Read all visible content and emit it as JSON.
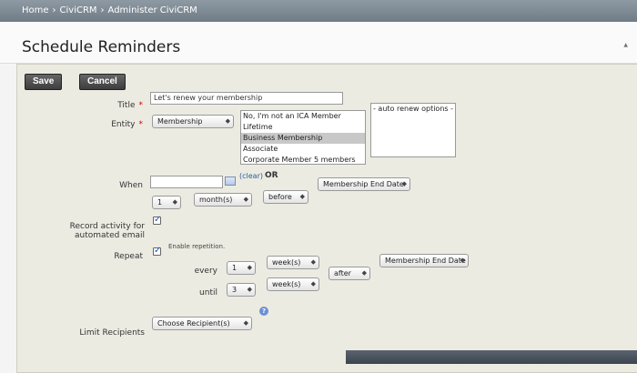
{
  "breadcrumb": {
    "items": [
      "Home",
      "CiviCRM",
      "Administer CiviCRM"
    ],
    "separator": "›"
  },
  "page": {
    "title": "Schedule Reminders"
  },
  "buttons": {
    "save": "Save",
    "cancel": "Cancel"
  },
  "fields": {
    "title": {
      "label": "Title",
      "value": "Let's renew your membership"
    },
    "entity": {
      "label": "Entity",
      "selected": "Membership",
      "options": [
        "No, I'm not an ICA Member",
        "Lifetime",
        "Business Membership",
        "Associate",
        "Corporate Member 5 members"
      ],
      "selected_option": "Business Membership",
      "auto_renew": "- auto renew options -"
    },
    "when": {
      "label": "When",
      "clear_link": "(clear)",
      "or": "OR",
      "number": "1",
      "unit": "month(s)",
      "relation": "before",
      "date_field": "Membership End Date"
    },
    "record_activity": {
      "label_line1": "Record activity for",
      "label_line2": "automated email"
    },
    "repeat": {
      "label": "Repeat",
      "enable_text": "Enable repetition.",
      "every_label": "every",
      "every_number": "1",
      "every_unit": "week(s)",
      "until_label": "until",
      "until_number": "3",
      "until_unit": "week(s)",
      "until_relation": "after",
      "until_date_field": "Membership End Date"
    },
    "limit_recipients": {
      "label": "Limit Recipients",
      "selected": "Choose Recipient(s)"
    }
  },
  "icons": {
    "help": "help-icon",
    "calendar": "calendar-icon",
    "collapse": "collapse-icon",
    "select_arrows": "◆"
  }
}
